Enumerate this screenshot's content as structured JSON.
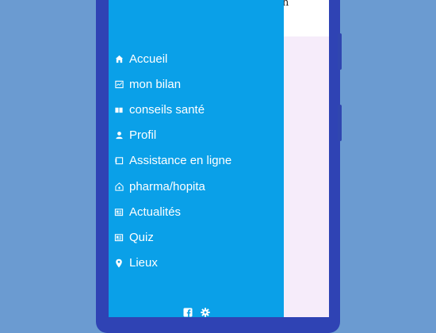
{
  "screen": {
    "header_glyph": "n"
  },
  "drawer": {
    "items": [
      {
        "label": "Accueil",
        "icon": "home-icon"
      },
      {
        "label": "mon bilan",
        "icon": "chart-icon"
      },
      {
        "label": "conseils santé",
        "icon": "book-icon"
      },
      {
        "label": "Profil",
        "icon": "user-icon"
      },
      {
        "label": "Assistance en ligne",
        "icon": "chat-icon"
      },
      {
        "label": "pharma/hopita",
        "icon": "hospital-icon"
      },
      {
        "label": "Actualités",
        "icon": "newspaper-icon"
      },
      {
        "label": "Quiz",
        "icon": "newspaper-icon"
      },
      {
        "label": "Lieux",
        "icon": "map-pin-icon"
      }
    ],
    "footer_icons": [
      "facebook-icon",
      "gear-icon"
    ]
  },
  "colors": {
    "drawer_bg": "#0aa0e8",
    "page_bg": "#6b9bd1",
    "phone_frame": "#2f43b4",
    "content_bg": "#f6ecfa"
  }
}
